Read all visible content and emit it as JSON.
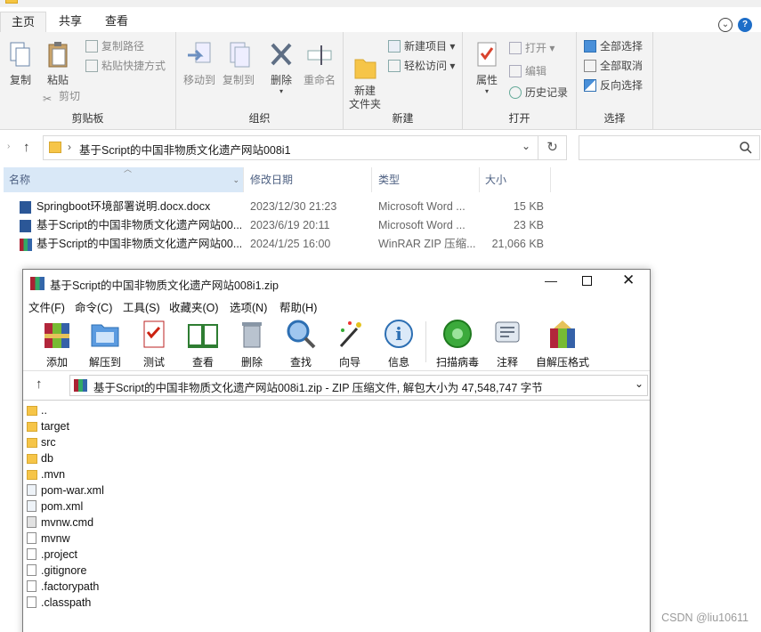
{
  "ribbon": {
    "tabs": [
      "主页",
      "共享",
      "查看"
    ],
    "groups": {
      "clipboard": {
        "label": "剪贴板",
        "copy": "复制",
        "paste": "粘贴",
        "copy_path": "复制路径",
        "paste_shortcut": "粘贴快捷方式",
        "cut": "剪切"
      },
      "organize": {
        "label": "组织",
        "move_to": "移动到",
        "copy_to": "复制到",
        "delete": "删除",
        "rename": "重命名"
      },
      "new": {
        "label": "新建",
        "new_folder": "新建\n文件夹",
        "new_item": "新建项目",
        "easy_access": "轻松访问"
      },
      "open": {
        "label": "打开",
        "properties": "属性",
        "open": "打开",
        "edit": "编辑",
        "history": "历史记录"
      },
      "select": {
        "label": "选择",
        "select_all": "全部选择",
        "select_none": "全部取消",
        "invert": "反向选择"
      }
    }
  },
  "address": {
    "path": "基于Script的中国非物质文化遗产网站008i1"
  },
  "file_list": {
    "headers": {
      "name": "名称",
      "date": "修改日期",
      "type": "类型",
      "size": "大小"
    },
    "rows": [
      {
        "name": "Springboot环境部署说明.docx.docx",
        "date": "2023/12/30 21:23",
        "type": "Microsoft Word ...",
        "size": "15 KB"
      },
      {
        "name": "基于Script的中国非物质文化遗产网站00...",
        "date": "2023/6/19 20:11",
        "type": "Microsoft Word ...",
        "size": "23 KB"
      },
      {
        "name": "基于Script的中国非物质文化遗产网站00...",
        "date": "2024/1/25 16:00",
        "type": "WinRAR ZIP 压缩...",
        "size": "21,066 KB"
      }
    ]
  },
  "winrar": {
    "title": "基于Script的中国非物质文化遗产网站008i1.zip",
    "menu": [
      "文件(F)",
      "命令(C)",
      "工具(S)",
      "收藏夹(O)",
      "选项(N)",
      "帮助(H)"
    ],
    "toolbar": [
      "添加",
      "解压到",
      "测试",
      "查看",
      "删除",
      "查找",
      "向导",
      "信息",
      "扫描病毒",
      "注释",
      "自解压格式"
    ],
    "path": "基于Script的中国非物质文化遗产网站008i1.zip - ZIP 压缩文件, 解包大小为 47,548,747 字节",
    "entries": [
      {
        "name": "..",
        "kind": "folder"
      },
      {
        "name": "target",
        "kind": "folder"
      },
      {
        "name": "src",
        "kind": "folder"
      },
      {
        "name": "db",
        "kind": "folder"
      },
      {
        "name": ".mvn",
        "kind": "folder"
      },
      {
        "name": "pom-war.xml",
        "kind": "xml"
      },
      {
        "name": "pom.xml",
        "kind": "xml"
      },
      {
        "name": "mvnw.cmd",
        "kind": "cmd"
      },
      {
        "name": "mvnw",
        "kind": "file"
      },
      {
        "name": ".project",
        "kind": "file"
      },
      {
        "name": ".gitignore",
        "kind": "file"
      },
      {
        "name": ".factorypath",
        "kind": "file"
      },
      {
        "name": ".classpath",
        "kind": "file"
      }
    ]
  },
  "watermark": "CSDN @liu10611"
}
